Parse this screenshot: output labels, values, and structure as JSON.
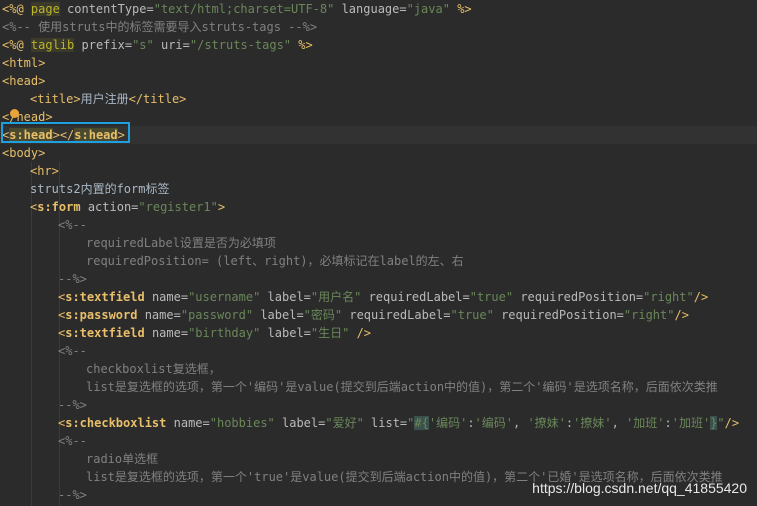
{
  "editor": {
    "lines": [
      {
        "highlight": false,
        "indent": 0,
        "segs": [
          {
            "c": "tag",
            "t": "<%@ "
          },
          {
            "c": "directive",
            "t": "page"
          },
          {
            "c": "attr",
            "t": " contentType="
          },
          {
            "c": "str",
            "t": "\"text/html;charset=UTF-8\""
          },
          {
            "c": "attr",
            "t": " language="
          },
          {
            "c": "str",
            "t": "\"java\""
          },
          {
            "c": "tag",
            "t": " %>"
          }
        ]
      },
      {
        "highlight": false,
        "indent": 0,
        "segs": [
          {
            "c": "cmt",
            "t": "<%-- 使用struts中的标签需要导入struts-tags --%>"
          }
        ]
      },
      {
        "highlight": false,
        "indent": 0,
        "segs": [
          {
            "c": "tag",
            "t": "<%@ "
          },
          {
            "c": "directive",
            "t": "taglib"
          },
          {
            "c": "attr",
            "t": " prefix="
          },
          {
            "c": "str",
            "t": "\"s\""
          },
          {
            "c": "attr",
            "t": " uri="
          },
          {
            "c": "str",
            "t": "\"/struts-tags\""
          },
          {
            "c": "tag",
            "t": " %>"
          }
        ]
      },
      {
        "highlight": false,
        "indent": 0,
        "segs": [
          {
            "c": "tag",
            "t": "<html>"
          }
        ]
      },
      {
        "highlight": false,
        "indent": 0,
        "segs": [
          {
            "c": "tag",
            "t": "<head>"
          }
        ]
      },
      {
        "highlight": false,
        "indent": 1,
        "segs": [
          {
            "c": "tag",
            "t": "<title>"
          },
          {
            "c": "text",
            "t": "用户注册"
          },
          {
            "c": "tag",
            "t": "</title>"
          }
        ]
      },
      {
        "highlight": false,
        "indent": 0,
        "segs": [
          {
            "c": "tag",
            "t": "</head>"
          }
        ]
      },
      {
        "highlight": true,
        "indent": 0,
        "segs": [
          {
            "c": "tag",
            "t": "<"
          },
          {
            "c": "hltag",
            "t": "s:head"
          },
          {
            "c": "tag",
            "t": "></"
          },
          {
            "c": "hltag",
            "t": "s:head"
          },
          {
            "c": "tag",
            "t": ">"
          }
        ]
      },
      {
        "highlight": false,
        "indent": 0,
        "segs": [
          {
            "c": "tag",
            "t": "<body>"
          }
        ]
      },
      {
        "highlight": false,
        "indent": 1,
        "segs": [
          {
            "c": "tag",
            "t": "<hr>"
          }
        ]
      },
      {
        "highlight": false,
        "indent": 1,
        "segs": [
          {
            "c": "text",
            "t": "struts2内置的form标签"
          }
        ]
      },
      {
        "highlight": false,
        "indent": 1,
        "segs": [
          {
            "c": "tag",
            "t": "<"
          },
          {
            "c": "tagname",
            "t": "s:form"
          },
          {
            "c": "attr",
            "t": " action="
          },
          {
            "c": "str",
            "t": "\"register1\""
          },
          {
            "c": "tag",
            "t": ">"
          }
        ]
      },
      {
        "highlight": false,
        "indent": 2,
        "segs": [
          {
            "c": "cmt",
            "t": "<%--"
          }
        ]
      },
      {
        "highlight": false,
        "indent": 3,
        "segs": [
          {
            "c": "cmt",
            "t": "requiredLabel设置是否为必填项"
          }
        ]
      },
      {
        "highlight": false,
        "indent": 3,
        "segs": [
          {
            "c": "cmt",
            "t": "requiredPosition= (left、right)，必填标记在label的左、右"
          }
        ]
      },
      {
        "highlight": false,
        "indent": 2,
        "segs": [
          {
            "c": "cmt",
            "t": "--%>"
          }
        ]
      },
      {
        "highlight": false,
        "indent": 2,
        "segs": [
          {
            "c": "tag",
            "t": "<"
          },
          {
            "c": "tagname",
            "t": "s:textfield"
          },
          {
            "c": "attr",
            "t": " name="
          },
          {
            "c": "str",
            "t": "\"username\""
          },
          {
            "c": "attr",
            "t": " label="
          },
          {
            "c": "str",
            "t": "\"用户名\""
          },
          {
            "c": "attr",
            "t": " requiredLabel="
          },
          {
            "c": "str",
            "t": "\"true\""
          },
          {
            "c": "attr",
            "t": " requiredPosition="
          },
          {
            "c": "str",
            "t": "\"right\""
          },
          {
            "c": "tag",
            "t": "/>"
          }
        ]
      },
      {
        "highlight": false,
        "indent": 2,
        "segs": [
          {
            "c": "tag",
            "t": "<"
          },
          {
            "c": "tagname",
            "t": "s:password"
          },
          {
            "c": "attr",
            "t": " name="
          },
          {
            "c": "str",
            "t": "\"password\""
          },
          {
            "c": "attr",
            "t": " label="
          },
          {
            "c": "str",
            "t": "\"密码\""
          },
          {
            "c": "attr",
            "t": " requiredLabel="
          },
          {
            "c": "str",
            "t": "\"true\""
          },
          {
            "c": "attr",
            "t": " requiredPosition="
          },
          {
            "c": "str",
            "t": "\"right\""
          },
          {
            "c": "tag",
            "t": "/>"
          }
        ]
      },
      {
        "highlight": false,
        "indent": 2,
        "segs": [
          {
            "c": "tag",
            "t": "<"
          },
          {
            "c": "tagname",
            "t": "s:textfield"
          },
          {
            "c": "attr",
            "t": " name="
          },
          {
            "c": "str",
            "t": "\"birthday\""
          },
          {
            "c": "attr",
            "t": " label="
          },
          {
            "c": "str",
            "t": "\"生日\""
          },
          {
            "c": "tag",
            "t": " />"
          }
        ]
      },
      {
        "highlight": false,
        "indent": 2,
        "segs": [
          {
            "c": "cmt",
            "t": "<%--"
          }
        ]
      },
      {
        "highlight": false,
        "indent": 3,
        "segs": [
          {
            "c": "cmt",
            "t": "checkboxlist复选框，"
          }
        ]
      },
      {
        "highlight": false,
        "indent": 3,
        "segs": [
          {
            "c": "cmt",
            "t": "list是复选框的选项，第一个'编码'是value(提交到后端action中的值)，第二个'编码'是选项名称，后面依次类推"
          }
        ]
      },
      {
        "highlight": false,
        "indent": 2,
        "segs": [
          {
            "c": "cmt",
            "t": "--%>"
          }
        ]
      },
      {
        "highlight": false,
        "indent": 2,
        "segs": [
          {
            "c": "tag",
            "t": "<"
          },
          {
            "c": "tagname",
            "t": "s:checkboxlist"
          },
          {
            "c": "attr",
            "t": " name="
          },
          {
            "c": "str",
            "t": "\"hobbies\""
          },
          {
            "c": "attr",
            "t": " label="
          },
          {
            "c": "str",
            "t": "\"爱好\""
          },
          {
            "c": "attr",
            "t": " list="
          },
          {
            "c": "str",
            "t": "\""
          },
          {
            "c": "ognl",
            "t": "#{"
          },
          {
            "c": "str",
            "t": "'编码'"
          },
          {
            "c": "text",
            "t": ":"
          },
          {
            "c": "str",
            "t": "'编码'"
          },
          {
            "c": "text",
            "t": ", "
          },
          {
            "c": "str",
            "t": "'撩妹'"
          },
          {
            "c": "text",
            "t": ":"
          },
          {
            "c": "str",
            "t": "'撩妹'"
          },
          {
            "c": "text",
            "t": ", "
          },
          {
            "c": "str",
            "t": "'加班'"
          },
          {
            "c": "text",
            "t": ":"
          },
          {
            "c": "str",
            "t": "'加班'"
          },
          {
            "c": "ognl",
            "t": "}"
          },
          {
            "c": "str",
            "t": "\""
          },
          {
            "c": "tag",
            "t": "/>"
          }
        ]
      },
      {
        "highlight": false,
        "indent": 2,
        "segs": [
          {
            "c": "cmt",
            "t": "<%--"
          }
        ]
      },
      {
        "highlight": false,
        "indent": 3,
        "segs": [
          {
            "c": "cmt",
            "t": "radio单选框"
          }
        ]
      },
      {
        "highlight": false,
        "indent": 3,
        "segs": [
          {
            "c": "cmt",
            "t": "list是复选框的选项，第一个'true'是value(提交到后端action中的值)，第二个'已婚'是选项名称，后面依次类推"
          }
        ]
      },
      {
        "highlight": false,
        "indent": 2,
        "segs": [
          {
            "c": "cmt",
            "t": "--%>"
          }
        ]
      }
    ]
  },
  "watermark": "https://blog.csdn.net/qq_41855420"
}
